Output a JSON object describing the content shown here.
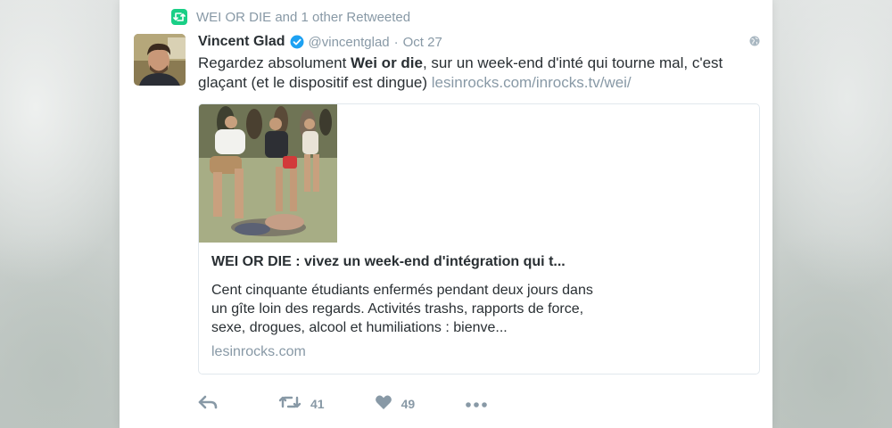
{
  "context": {
    "text": "WEI OR DIE and 1 other Retweeted",
    "icon": "retweet-icon"
  },
  "tweet": {
    "author_name": "Vincent Glad",
    "handle": "@vincentglad",
    "separator": "·",
    "date": "Oct 27",
    "verified_icon": "verified-badge-icon",
    "text_before": "Regardez absolument ",
    "text_bold": "Wei or die",
    "text_after": ", sur un week-end d'inté qui tourne mal, c'est glaçant (et le dispositif est dingue) ",
    "link_text": "lesinrocks.com/inrocks.tv/wei/",
    "colors": {
      "text": "#292f33",
      "muted": "#8899a6",
      "verified": "#1da1f2",
      "retweet_green": "#19cf86"
    }
  },
  "link_card": {
    "title": "WEI OR DIE : vivez un week-end d'intégration qui t...",
    "description": "Cent cinquante étudiants enfermés pendant deux jours dans un gîte loin des regards. Activités trashs, rapports de force, sexe, drogues, alcool et humiliations : bienve...",
    "domain": "lesinrocks.com"
  },
  "actions": {
    "reply_icon": "reply-icon",
    "retweet_icon": "retweet-icon",
    "retweet_count": "41",
    "like_icon": "heart-icon",
    "like_count": "49",
    "more_icon": "more-dots-icon"
  }
}
